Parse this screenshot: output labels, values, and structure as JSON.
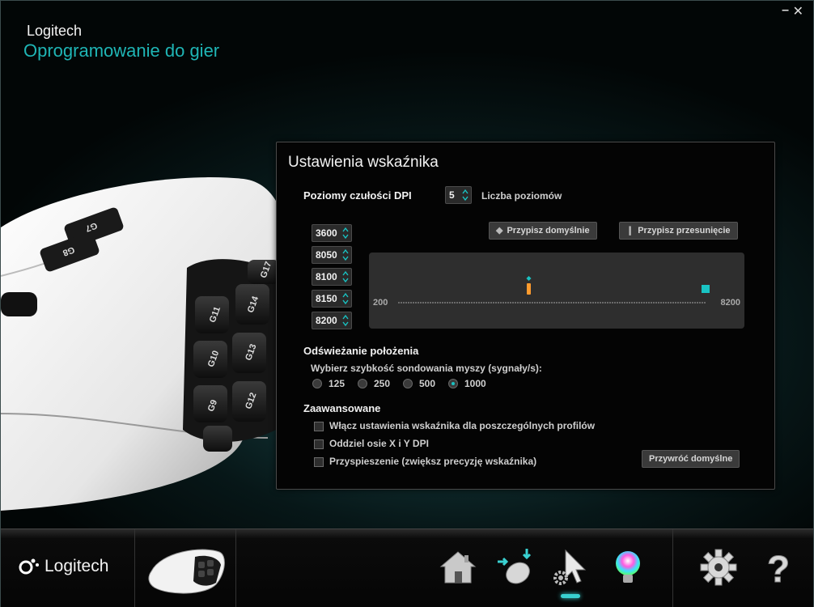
{
  "app": {
    "brand": "Logitech",
    "subtitle": "Oprogramowanie do gier",
    "window_controls": {
      "minimize": "–",
      "close": "✕"
    }
  },
  "mouse_keys": [
    "G7",
    "G8",
    "G14",
    "G11",
    "G13",
    "G10",
    "G12",
    "G9",
    "G17"
  ],
  "panel": {
    "title": "Ustawienia wskaźnika",
    "dpi": {
      "section_title": "Poziomy czułości DPI",
      "level_count": "5",
      "level_count_label": "Liczba poziomów",
      "levels": [
        "3600",
        "8050",
        "8100",
        "8150",
        "8200"
      ],
      "assign_default_label": "Przypisz domyślnie",
      "assign_shift_label": "Przypisz przesunięcie",
      "axis_min": "200",
      "axis_max": "8200",
      "marker_value": 3600,
      "shift_marker_value": 8200,
      "accent_color": "#19c3c3",
      "marker_color": "#ff9b2e"
    },
    "polling": {
      "section_title": "Odświeżanie położenia",
      "prompt": "Wybierz szybkość sondowania myszy (sygnały/s):",
      "options": [
        "125",
        "250",
        "500",
        "1000"
      ],
      "selected": "1000"
    },
    "advanced": {
      "section_title": "Zaawansowane",
      "options": [
        "Włącz ustawienia wskaźnika dla poszczególnych profilów",
        "Oddziel osie X i Y DPI",
        "Przyspieszenie (zwiększ precyzję wskaźnika)"
      ],
      "restore_defaults_label": "Przywróć domyślne"
    }
  },
  "bottom_bar": {
    "logo_text": "Logitech",
    "icons": [
      "home-icon",
      "customize-buttons-icon",
      "pointer-settings-icon",
      "lighting-icon",
      "gear-icon",
      "help-icon"
    ],
    "active": "pointer-settings-icon",
    "active_color": "#39d0d0"
  }
}
